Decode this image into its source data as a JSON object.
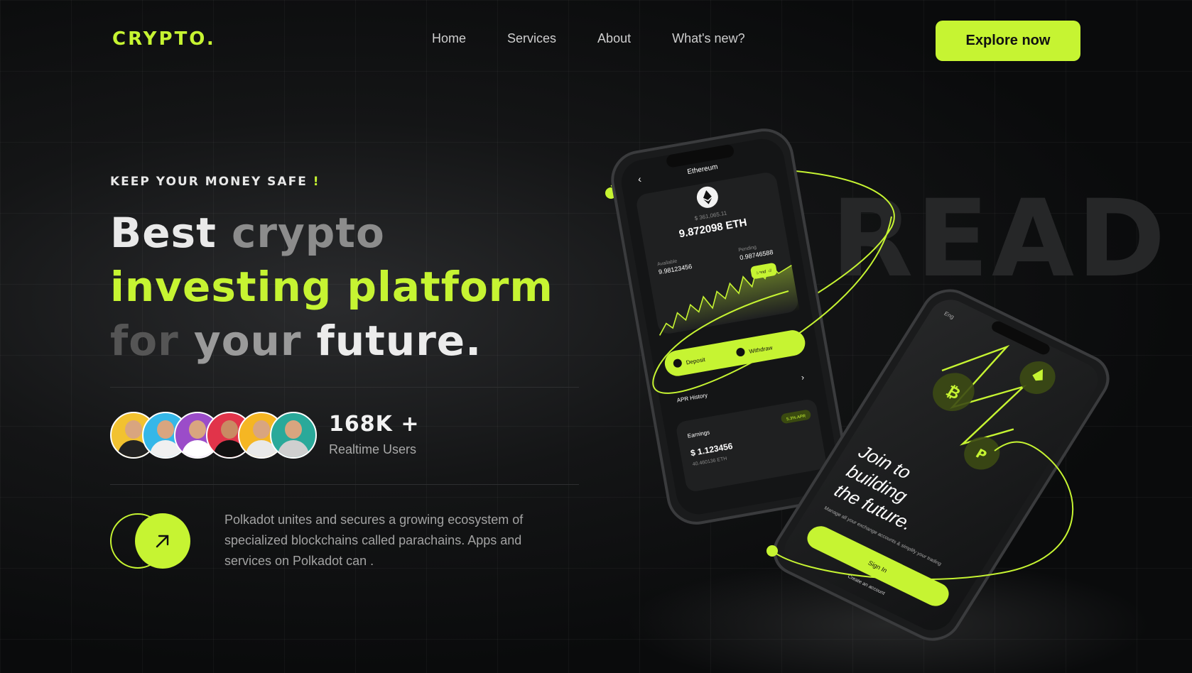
{
  "brand": {
    "logo": "CRYPTO.",
    "accent": "#c6f432"
  },
  "nav": {
    "items": [
      "Home",
      "Services",
      "About",
      "What's new?"
    ]
  },
  "cta": {
    "label": "Explore now"
  },
  "hero": {
    "kicker": "KEEP YOUR MONEY SAFE",
    "kicker_mark": "!",
    "line1_a": "Best",
    "line1_b": "crypto",
    "line2": "investing platform",
    "line3_a": "for",
    "line3_b": "your",
    "line3_c": "future."
  },
  "users": {
    "count": "168K +",
    "label": "Realtime Users"
  },
  "description": "Polkadot unites and secures a growing ecosystem of specialized blockchains called parachains. Apps and services on Polkadot can .",
  "background_word": "READ",
  "phone1": {
    "title": "Ethereum",
    "sub_value": "$ 361,065.11",
    "balance": "9.872098 ETH",
    "left_label": "Available",
    "left_value": "9.98123456",
    "right_label": "Pending",
    "right_value": "0.98746588",
    "badge": "Send All",
    "deposit": "Deposit",
    "withdraw": "Withdraw",
    "apr_history": "APR History",
    "earnings_label": "Earnings",
    "earnings_pill": "5.3% APR",
    "earnings_value": "$ 1.123456",
    "earnings_eth": "40.460136 ETH"
  },
  "phone2": {
    "tagline_1": "Join to",
    "tagline_2": "building",
    "tagline_3": "the future.",
    "sub": "Manage all your exchange accounts & simplify your trading",
    "sign_in": "Sign In",
    "create": "Create an account",
    "lang": "Eng"
  }
}
